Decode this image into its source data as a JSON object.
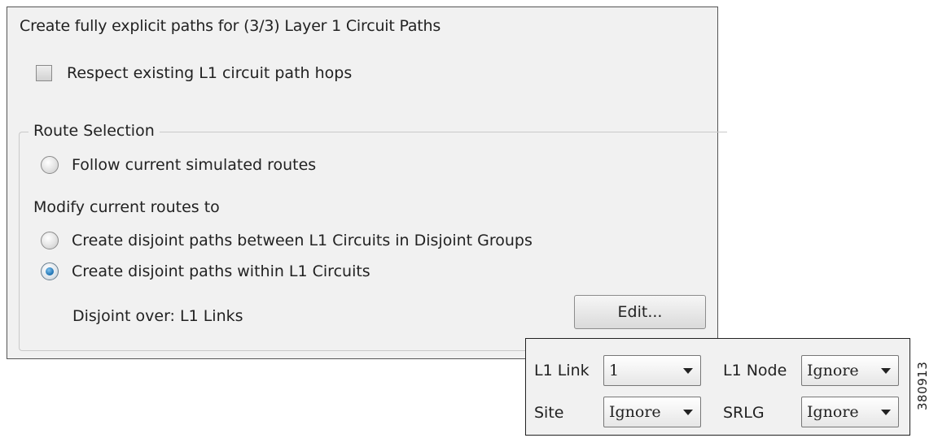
{
  "dialog": {
    "title": "Create fully explicit paths for (3/3) Layer 1 Circuit Paths",
    "respect_hops": {
      "label": "Respect existing L1 circuit path hops",
      "checked": false
    },
    "route_selection": {
      "legend": "Route Selection",
      "follow_label": "Follow current simulated routes",
      "modify_label": "Modify current routes to",
      "disjoint_groups_label": "Create disjoint paths between L1 Circuits in Disjoint Groups",
      "disjoint_within_label": "Create disjoint paths within L1 Circuits",
      "selected": "disjoint_within",
      "disjoint_over": "Disjoint over: L1 Links",
      "edit_label": "Edit..."
    }
  },
  "options": {
    "l1_link": {
      "label": "L1 Link",
      "value": "1"
    },
    "l1_node": {
      "label": "L1 Node",
      "value": "Ignore"
    },
    "site": {
      "label": "Site",
      "value": "Ignore"
    },
    "srlg": {
      "label": "SRLG",
      "value": "Ignore"
    }
  },
  "figure_number": "380913",
  "colors": {
    "panel_bg": "#f1f1f1",
    "radio_selected": "#1a6fb0"
  },
  "icons": {
    "combo_arrow": "chevron-down-icon"
  }
}
